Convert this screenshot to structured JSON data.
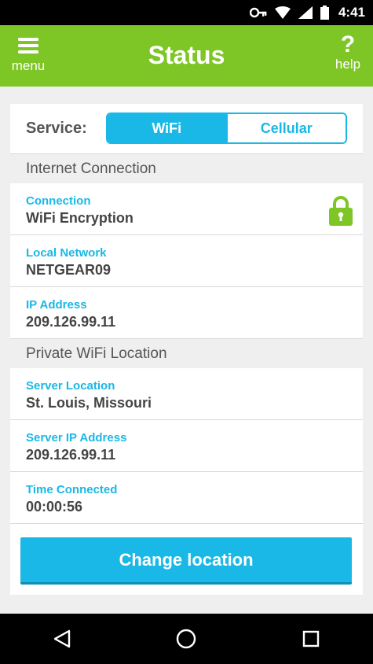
{
  "status_bar": {
    "time": "4:41"
  },
  "app_bar": {
    "title": "Status",
    "menu_label": "menu",
    "help_label": "help",
    "help_glyph": "?"
  },
  "service": {
    "label": "Service:",
    "options": [
      "WiFi",
      "Cellular"
    ],
    "selected": "WiFi"
  },
  "sections": [
    {
      "header": "Internet Connection",
      "rows": [
        {
          "label": "Connection",
          "value": "WiFi Encryption",
          "icon": "lock-icon"
        },
        {
          "label": "Local Network",
          "value": "NETGEAR09"
        },
        {
          "label": "IP Address",
          "value": "209.126.99.11"
        }
      ]
    },
    {
      "header": "Private WiFi Location",
      "rows": [
        {
          "label": "Server Location",
          "value": "St. Louis, Missouri"
        },
        {
          "label": "Server IP Address",
          "value": "209.126.99.11"
        },
        {
          "label": "Time Connected",
          "value": "00:00:56"
        }
      ]
    }
  ],
  "action_button": "Change location",
  "colors": {
    "brand_green": "#7ec626",
    "accent_blue": "#19b8e6"
  }
}
